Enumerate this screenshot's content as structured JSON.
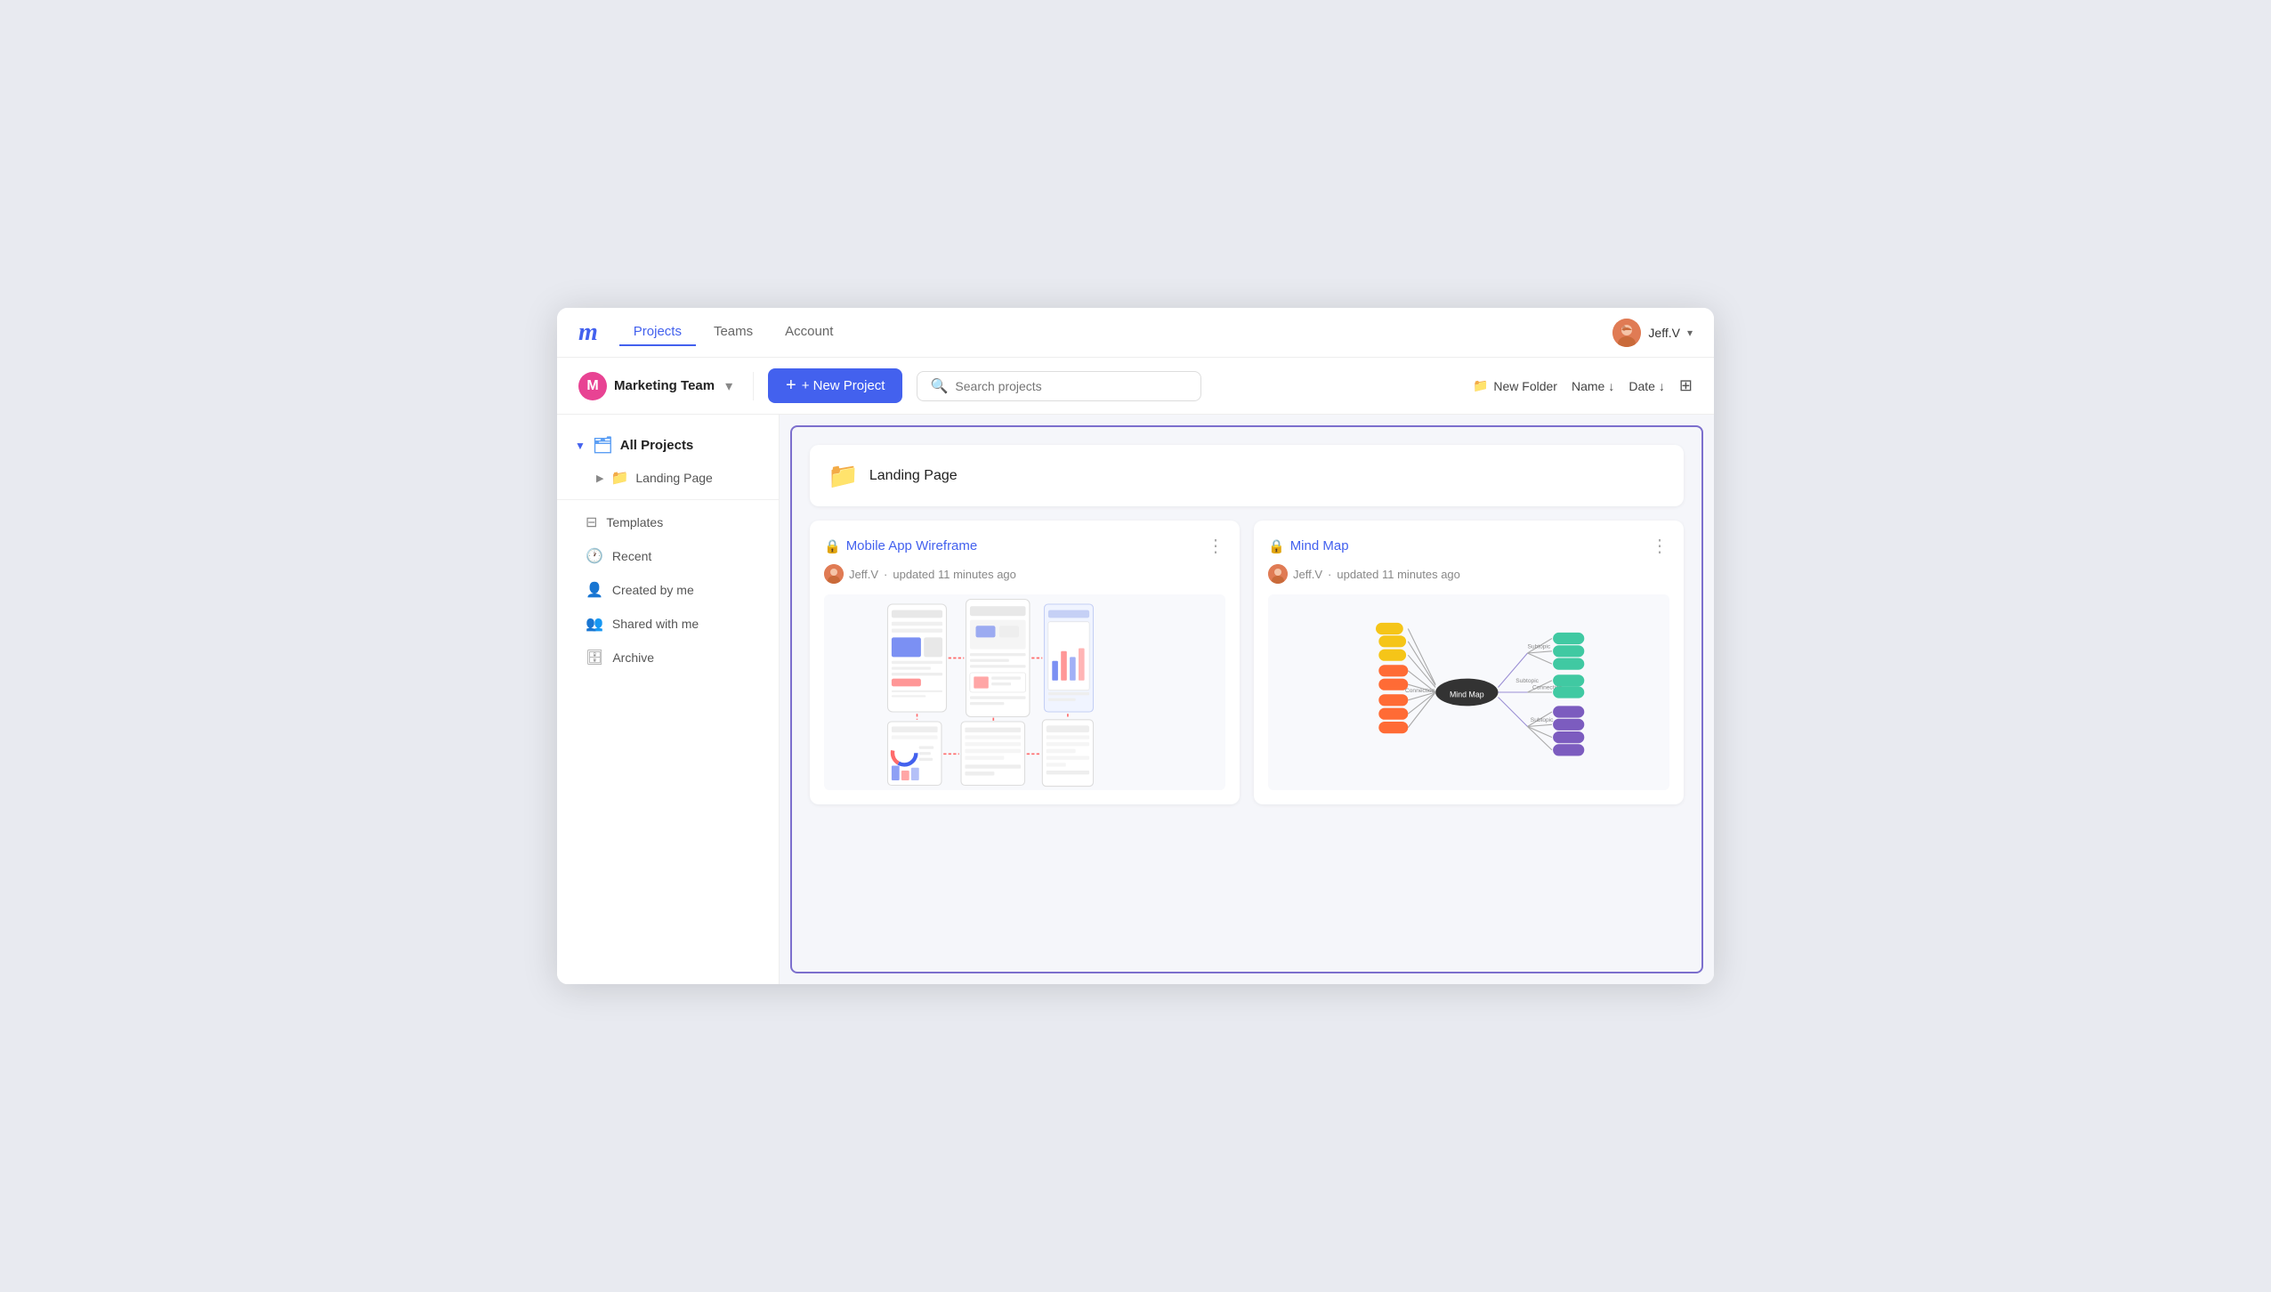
{
  "app": {
    "logo": "m",
    "nav": {
      "tabs": [
        {
          "label": "Projects",
          "active": true
        },
        {
          "label": "Teams",
          "active": false
        },
        {
          "label": "Account",
          "active": false
        }
      ]
    },
    "user": {
      "name": "Jeff.V",
      "chevron": "▾"
    }
  },
  "toolbar": {
    "team": {
      "initial": "M",
      "name": "Marketing Team"
    },
    "new_project_label": "+ New Project",
    "search_placeholder": "Search projects",
    "new_folder_label": "New Folder",
    "sort_name_label": "Name",
    "sort_date_label": "Date",
    "sort_arrow": "↓"
  },
  "sidebar": {
    "all_projects_label": "All Projects",
    "items": [
      {
        "label": "Landing Page",
        "type": "folder"
      },
      {
        "label": "Templates",
        "type": "templates"
      },
      {
        "label": "Recent",
        "type": "recent"
      },
      {
        "label": "Created by me",
        "type": "created"
      },
      {
        "label": "Shared with me",
        "type": "shared"
      },
      {
        "label": "Archive",
        "type": "archive"
      }
    ]
  },
  "projects": {
    "folder": {
      "name": "Landing Page"
    },
    "cards": [
      {
        "title": "Mobile App Wireframe",
        "author": "Jeff.V",
        "updated": "updated 11 minutes ago",
        "type": "wireframe"
      },
      {
        "title": "Mind Map",
        "author": "Jeff.V",
        "updated": "updated 11 minutes ago",
        "type": "mindmap"
      }
    ]
  }
}
